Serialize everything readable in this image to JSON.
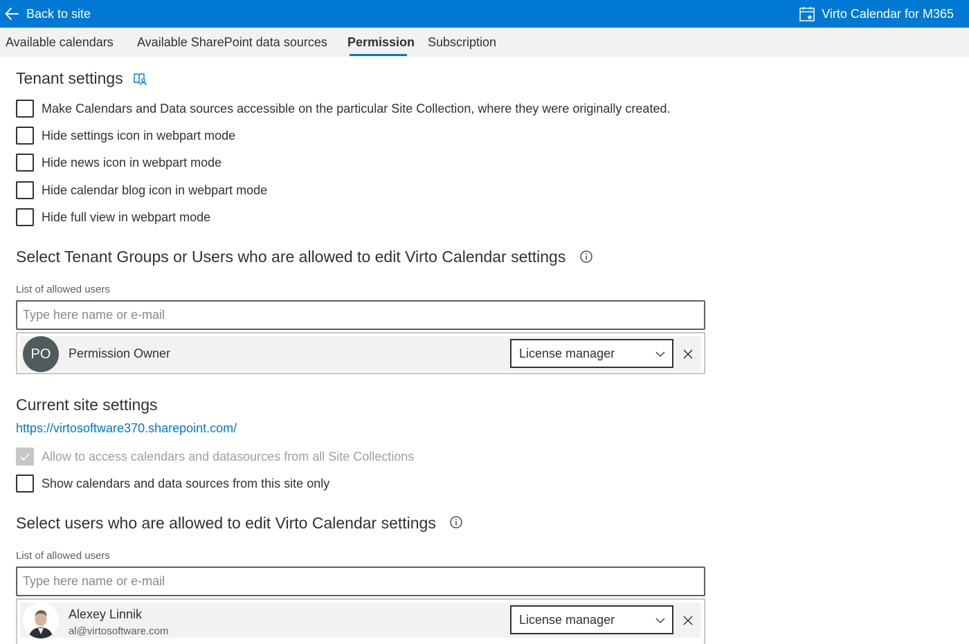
{
  "topbar": {
    "back_label": "Back to site",
    "app_title": "Virto Calendar for M365",
    "color": "#0078d4"
  },
  "tabs": [
    {
      "label": "Available calendars",
      "active": false
    },
    {
      "label": "Available SharePoint data sources",
      "active": false
    },
    {
      "label": "Permission",
      "active": true
    },
    {
      "label": "Subscription",
      "active": false
    }
  ],
  "tenant": {
    "title": "Tenant settings",
    "checkboxes": [
      {
        "label": "Make Calendars and Data sources accessible on the particular Site Collection, where they were originally created.",
        "checked": false
      },
      {
        "label": "Hide settings icon in webpart mode",
        "checked": false
      },
      {
        "label": "Hide news icon in webpart mode",
        "checked": false
      },
      {
        "label": "Hide calendar blog icon in webpart mode",
        "checked": false
      },
      {
        "label": "Hide full view in webpart mode",
        "checked": false
      }
    ],
    "users_heading": "Select Tenant Groups or Users who are allowed to edit Virto Calendar settings",
    "list_label": "List of allowed users",
    "input_placeholder": "Type here name or e-mail",
    "people": [
      {
        "initials": "PO",
        "name": "Permission Owner",
        "role": "License manager"
      }
    ]
  },
  "site": {
    "title": "Current site settings",
    "url": "https://virtosoftware370.sharepoint.com/",
    "checkboxes": [
      {
        "label": "Allow to access calendars and datasources from all Site Collections",
        "checked": true,
        "disabled": true
      },
      {
        "label": "Show calendars and data sources from this site only",
        "checked": false,
        "disabled": false
      }
    ],
    "users_heading": "Select users who are allowed to edit Virto Calendar settings",
    "list_label": "List of allowed users",
    "input_placeholder": "Type here name or e-mail",
    "people": [
      {
        "name": "Alexey Linnik",
        "email": "al@virtosoftware.com",
        "role": "License manager"
      }
    ]
  }
}
